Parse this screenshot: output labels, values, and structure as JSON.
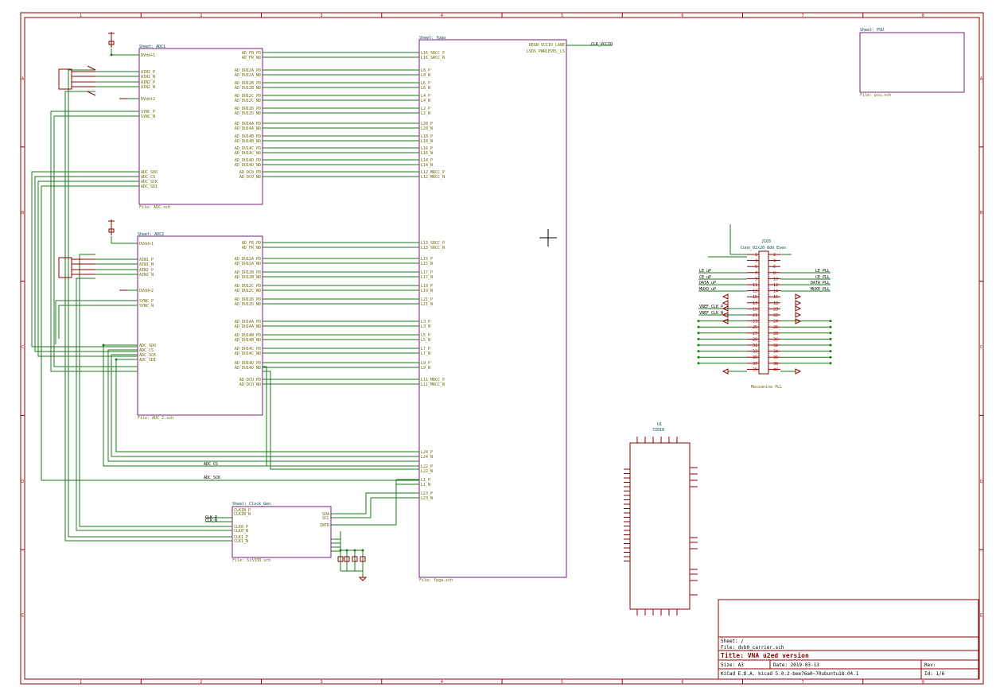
{
  "frame": {
    "columns": [
      "1",
      "2",
      "3",
      "4",
      "5",
      "6",
      "7",
      "8"
    ],
    "rows": [
      "A",
      "B",
      "C",
      "D",
      "E"
    ]
  },
  "title_block": {
    "sheet_label": "Sheet: /",
    "file_label": "File: dvb0_carrier.sch",
    "title": "Title: VNA u2ed version",
    "size": "Size: A3",
    "date": "Date: 2019-03-13",
    "rev": "Rev:",
    "kicad": "KiCad E.D.A.  kicad 5.0.2-bee76a0~70ubuntu18.04.1",
    "id": "Id: 1/6"
  },
  "sheets": {
    "adc1": {
      "name": "Sheet: ADC1",
      "file": "File: ADC.sch",
      "left_pins": [
        "DVdd+1",
        "AIN1_P",
        "AIN1_N",
        "AIN2_P",
        "AIN2_N",
        "DVdd+2",
        "SYNC_P",
        "SYNC_N",
        "ADC_SDO",
        "ADC_CS",
        "ADC_SCK",
        "ADC_SDI"
      ],
      "right_pins": [
        "AD_FR_PD",
        "AD_FR_ND",
        "AD_DU12A_PD",
        "AD_DU12A_ND",
        "AD_DU12B_PD",
        "AD_DU12B_ND",
        "AD_DU12C_PD",
        "AD_DU12C_ND",
        "AD_DU12D_PD",
        "AD_DU12D_ND",
        "AD_DU14A_PD",
        "AD_DU14A_ND",
        "AD_DU14B_PD",
        "AD_DU14B_ND",
        "AD_DU14C_PD",
        "AD_DU14C_ND",
        "AD_DU14D_PD",
        "AD_DU14D_ND",
        "AD_DCO_PD",
        "AD_DCO_ND"
      ]
    },
    "adc2": {
      "name": "Sheet: ADC2",
      "file": "File: ADC_2.sch",
      "left_pins": [
        "DVdd+1",
        "AIN1_P",
        "AIN1_N",
        "AIN2_P",
        "AIN2_N",
        "DVdd+2",
        "SYNC_P",
        "SYNC_N",
        "ADC_SDO",
        "ADC_CS",
        "ADC_SCK",
        "ADC_SDI"
      ],
      "right_pins": [
        "AD_FR_PD",
        "AD_FR_ND",
        "AD_DU12A_PD",
        "AD_DU12A_ND",
        "AD_DU12B_PD",
        "AD_DU12B_ND",
        "AD_DU12C_PD",
        "AD_DU12C_ND",
        "AD_DU12D_PD",
        "AD_DU12D_ND",
        "AD_DU14A_PD",
        "AD_DU14A_ND",
        "AD_DU14B_PD",
        "AD_DU14B_ND",
        "AD_DU14C_PD",
        "AD_DU14C_ND",
        "AD_DU14D_PD",
        "AD_DU14D_ND",
        "AD_DCO_PD",
        "AD_DCO_ND"
      ]
    },
    "fpga": {
      "name": "Sheet: fpga",
      "file": "File: fpga.sch",
      "top_right_pins": [
        "REGN VCCIO_LANE",
        "LVDS_PWRLEVEL_LS"
      ],
      "top_left_pins": [
        "L16_SRCC_P",
        "L16_SRCC_N",
        "L8_P",
        "L8_N",
        "L6_P",
        "L6_N",
        "L4_P",
        "L4_N",
        "L2_P",
        "L2_N",
        "L20_P",
        "L20_N",
        "L18_P",
        "L18_N",
        "L16_P",
        "L16_N",
        "L14_P",
        "L14_N",
        "L12_MRCC_P",
        "L12_MRCC_N"
      ],
      "mid_left_pins": [
        "L13_SRCC_P",
        "L13_SRCC_N",
        "L15_P",
        "L15_N",
        "L17_P",
        "L17_N",
        "L19_P",
        "L19_N",
        "L21_P",
        "L21_N",
        "L3_P",
        "L3_N",
        "L5_P",
        "L5_N",
        "L7_P",
        "L7_N",
        "L9_P",
        "L9_N",
        "L11_MRCC_P",
        "L11_MRCC_N"
      ],
      "bottom_left_pins": [
        "L24_P",
        "L24_N",
        "L22_P",
        "L22_N",
        "L1_P",
        "L1_N",
        "L23_P",
        "L23_N"
      ]
    },
    "psu": {
      "name": "Sheet: PSU",
      "file": "File: psu.sch"
    },
    "synth": {
      "name": "Sheet: Clock_Gen",
      "file": "File: Si5338.sch",
      "left_pins": [
        "CLKIN_P",
        "CLKIN_N",
        "CLK0_P",
        "CLK0_N",
        "CLK1_P",
        "CLK1_N"
      ],
      "right_pins": [
        "SDA",
        "SCL",
        "INTR"
      ]
    }
  },
  "nets": {
    "clk_vccio": "CLK_VCCIO",
    "adc_cs": "ADC_CS",
    "adc_sck": "ADC_SCK",
    "ext_clk_p": "CLK_P",
    "ext_clk_n": "CLK_N"
  },
  "connector": {
    "ref": "J103",
    "value": "Conn_02x20_Odd_Even",
    "footer": "Mezzanine PLL",
    "left_labels": [
      "LE_uP",
      "CE_uP",
      "DATA_uP",
      "MUXO_uP",
      "",
      "VREF_CLK_P",
      "VREF_CLK_N"
    ],
    "right_labels": [
      "LE_PLL",
      "CE_PLL",
      "DATA_PLL",
      "MUXO_PLL"
    ],
    "pin_left": [
      "1",
      "3",
      "5",
      "7",
      "9",
      "11",
      "13",
      "15",
      "17",
      "19",
      "21",
      "23",
      "25",
      "27",
      "29",
      "31",
      "33",
      "35",
      "37",
      "39"
    ],
    "pin_right": [
      "2",
      "4",
      "6",
      "8",
      "10",
      "12",
      "14",
      "16",
      "18",
      "20",
      "22",
      "24",
      "26",
      "28",
      "30",
      "32",
      "34",
      "36",
      "38",
      "40"
    ]
  },
  "fpga_ic": {
    "ref": "U1",
    "value": "7Z010"
  }
}
